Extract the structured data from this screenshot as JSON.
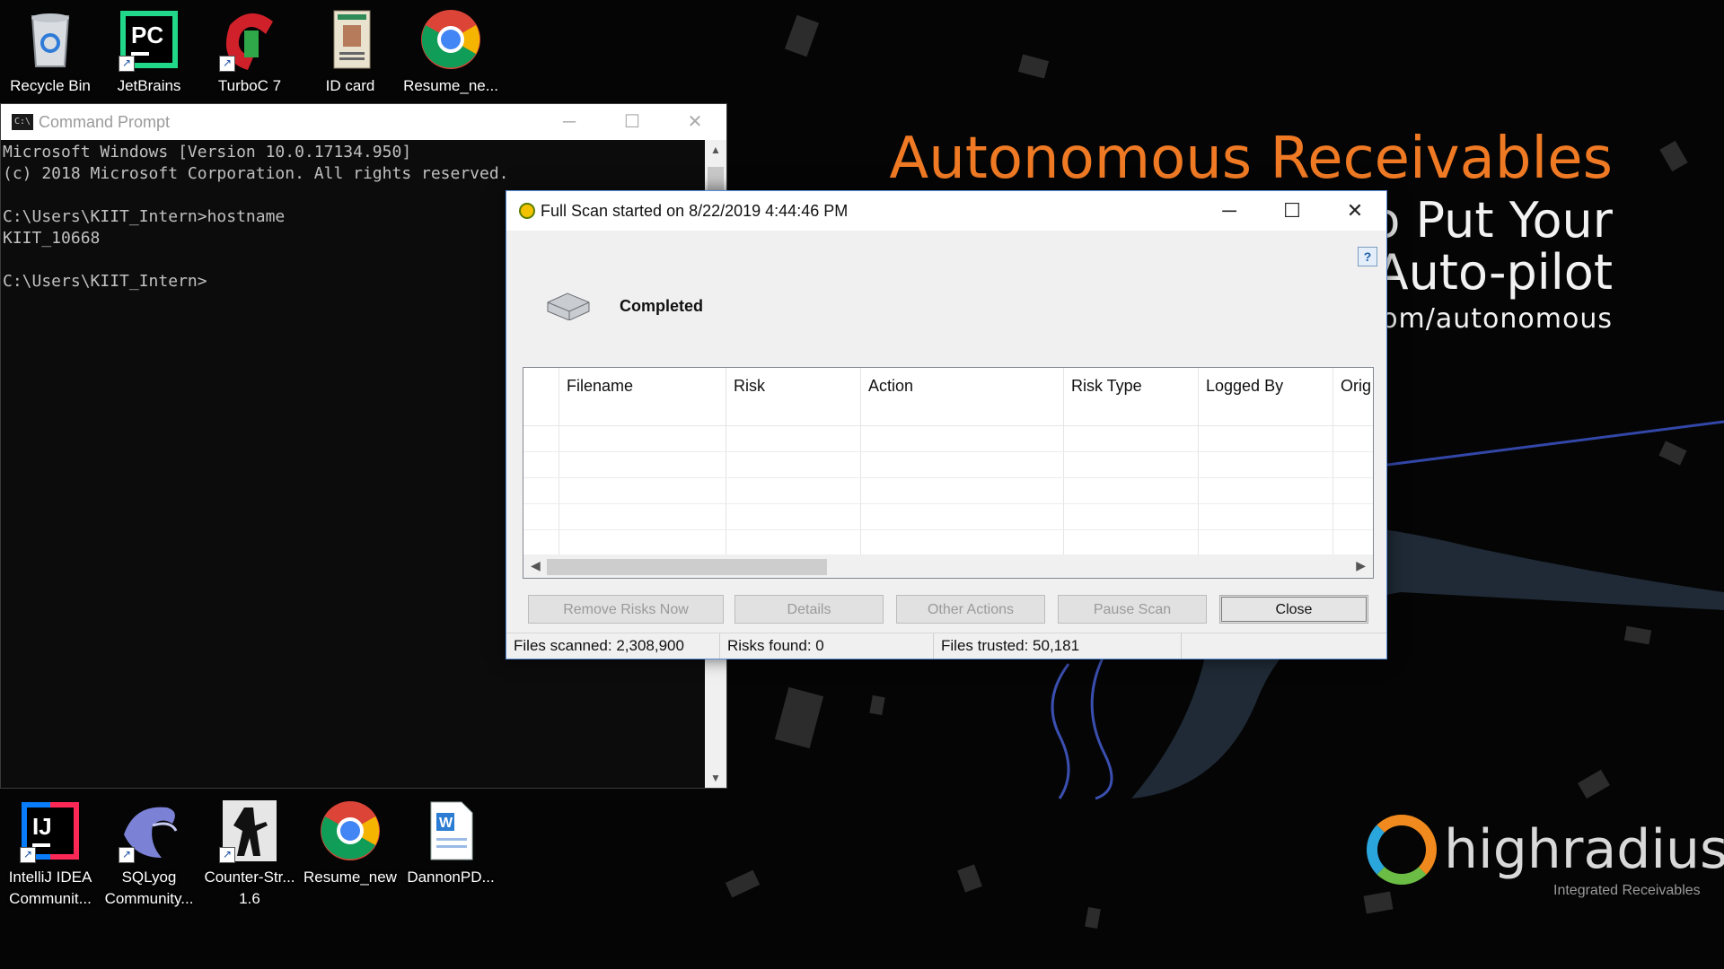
{
  "desktop": {
    "top_icons": [
      {
        "label": "Recycle Bin",
        "icon": "recycle-bin-icon"
      },
      {
        "label": "JetBrains",
        "icon": "pycharm-icon"
      },
      {
        "label": "TurboC 7",
        "icon": "turboc-icon"
      },
      {
        "label": "ID card",
        "icon": "id-card-icon"
      },
      {
        "label": "Resume_ne...",
        "icon": "chrome-icon"
      }
    ],
    "bottom_icons": [
      {
        "label_line1": "IntelliJ IDEA",
        "label_line2": "Communit...",
        "icon": "intellij-icon"
      },
      {
        "label_line1": "SQLyog",
        "label_line2": "Community...",
        "icon": "sqlyog-dolphin-icon"
      },
      {
        "label_line1": "Counter-Str...",
        "label_line2": "1.6",
        "icon": "counter-strike-icon"
      },
      {
        "label_line1": "Resume_new",
        "label_line2": "",
        "icon": "chrome-icon"
      },
      {
        "label_line1": "DannonPD...",
        "label_line2": "",
        "icon": "word-document-icon"
      }
    ]
  },
  "wallpaper": {
    "title": "Autonomous Receivables",
    "line2": "o Put Your",
    "line3": "Auto-pilot",
    "line4": "com/autonomous",
    "brand": "highradius",
    "tagline": "Integrated Receivables",
    "accent_color": "#f07a24"
  },
  "cmd": {
    "title": "Command Prompt",
    "icon": "console-icon",
    "output": "Microsoft Windows [Version 10.0.17134.950]\n(c) 2018 Microsoft Corporation. All rights reserved.\n\nC:\\Users\\KIIT_Intern>hostname\nKIIT_10668\n\nC:\\Users\\KIIT_Intern>"
  },
  "scan": {
    "title": "Full Scan started on 8/22/2019 4:44:46 PM",
    "status": "Completed",
    "columns": [
      "Filename",
      "Risk",
      "Action",
      "Risk Type",
      "Logged By",
      "Orig"
    ],
    "buttons": {
      "remove_risks": "Remove Risks Now",
      "details": "Details",
      "other_actions": "Other Actions",
      "pause_scan": "Pause Scan",
      "close": "Close"
    },
    "statusbar": {
      "files_scanned": "Files scanned: 2,308,900",
      "risks_found": "Risks found: 0",
      "files_trusted": "Files trusted: 50,181"
    }
  }
}
